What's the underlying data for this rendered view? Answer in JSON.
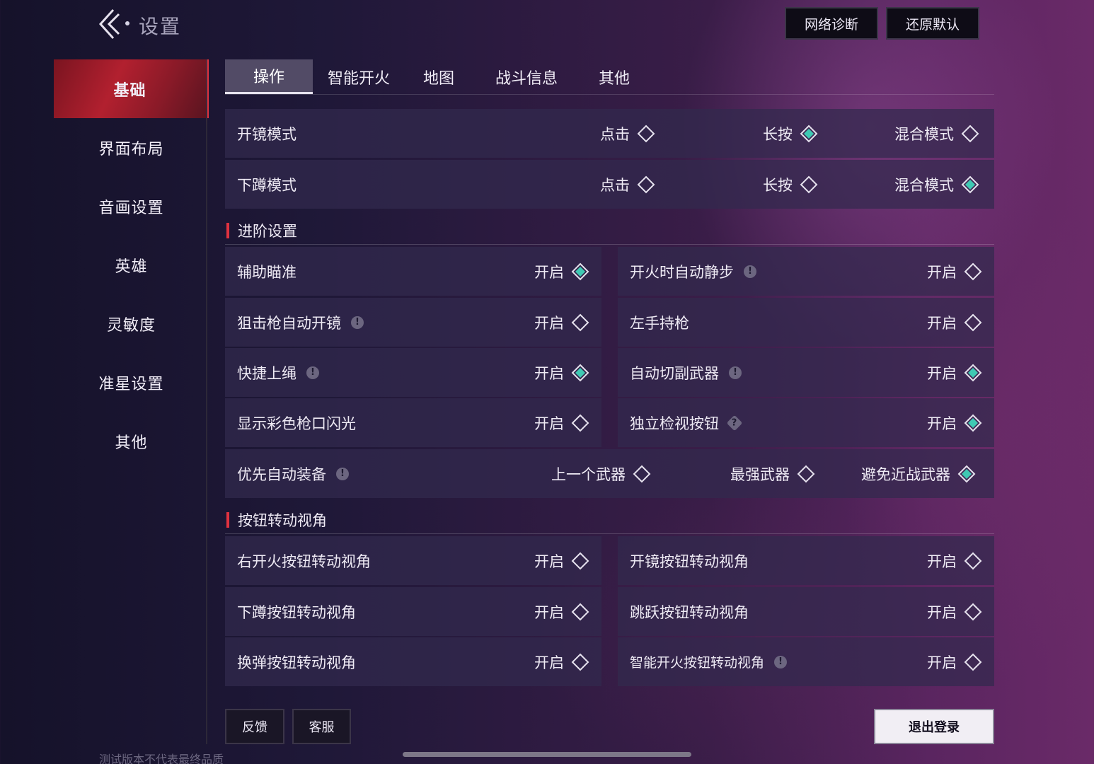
{
  "header": {
    "title": "设置",
    "network_button": "网络诊断",
    "reset_button": "还原默认"
  },
  "sidebar": {
    "items": [
      {
        "label": "基础",
        "active": true
      },
      {
        "label": "界面布局"
      },
      {
        "label": "音画设置"
      },
      {
        "label": "英雄"
      },
      {
        "label": "灵敏度"
      },
      {
        "label": "准星设置"
      },
      {
        "label": "其他"
      }
    ]
  },
  "tabs": [
    {
      "label": "操作",
      "active": true
    },
    {
      "label": "智能开火"
    },
    {
      "label": "地图"
    },
    {
      "label": "战斗信息"
    },
    {
      "label": "其他"
    }
  ],
  "modes": {
    "scope": {
      "label": "开镜模式",
      "opt1": "点击",
      "opt2": "长按",
      "opt3": "混合模式",
      "selected": "长按"
    },
    "crouch": {
      "label": "下蹲模式",
      "opt1": "点击",
      "opt2": "长按",
      "opt3": "混合模式",
      "selected": "混合模式"
    }
  },
  "advanced": {
    "title": "进阶设置",
    "on_label": "开启",
    "items": [
      {
        "label": "辅助瞄准",
        "checked": true,
        "info": ""
      },
      {
        "label": "开火时自动静步",
        "checked": false,
        "info": "!"
      },
      {
        "label": "狙击枪自动开镜",
        "checked": false,
        "info": "!"
      },
      {
        "label": "左手持枪",
        "checked": false,
        "info": ""
      },
      {
        "label": "快捷上绳",
        "checked": true,
        "info": "!"
      },
      {
        "label": "自动切副武器",
        "checked": true,
        "info": "!"
      },
      {
        "label": "显示彩色枪口闪光",
        "checked": false,
        "info": ""
      },
      {
        "label": "独立检视按钮",
        "checked": true,
        "info": "?"
      }
    ],
    "auto_equip": {
      "label": "优先自动装备",
      "opt1": "上一个武器",
      "opt2": "最强武器",
      "opt3": "避免近战武器",
      "selected": "避免近战武器"
    }
  },
  "view_rotate": {
    "title": "按钮转动视角",
    "on_label": "开启",
    "items": [
      {
        "label": "右开火按钮转动视角",
        "checked": false
      },
      {
        "label": "开镜按钮转动视角",
        "checked": false
      },
      {
        "label": "下蹲按钮转动视角",
        "checked": false
      },
      {
        "label": "跳跃按钮转动视角",
        "checked": false
      },
      {
        "label": "换弹按钮转动视角",
        "checked": false
      },
      {
        "label": "智能开火按钮转动视角",
        "checked": false,
        "info": "!"
      }
    ]
  },
  "footer": {
    "feedback": "反馈",
    "service": "客服",
    "logout": "退出登录",
    "note": "测试版本不代表最终品质"
  },
  "colors": {
    "accent_red": "#e0323f",
    "check_teal": "#3fc9b3",
    "row_bg": "#322a4e"
  }
}
